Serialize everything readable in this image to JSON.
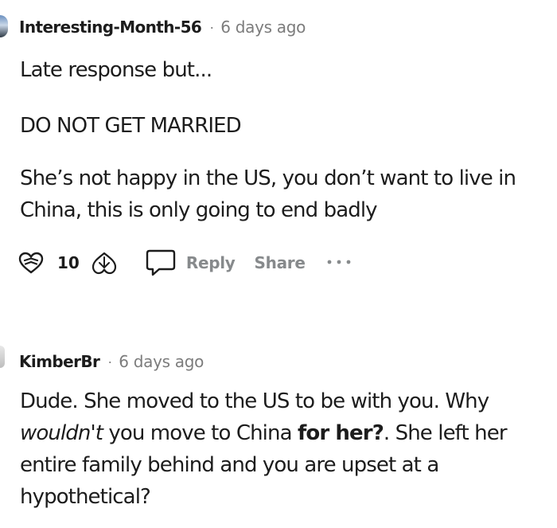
{
  "comments": [
    {
      "author": "Interesting-Month-56",
      "separator": "·",
      "time": "6 days ago",
      "paragraphs": [
        "Late response but...",
        "DO NOT GET MARRIED",
        "She’s not happy in the US, you don’t want to live in",
        "China, this is only going to end badly"
      ],
      "vote_count": "10",
      "reply_label": "Reply",
      "share_label": "Share",
      "more_label": "•••"
    },
    {
      "author": "KimberBr",
      "separator": "·",
      "time": "6 days ago",
      "lines": {
        "l1": "Dude. She moved to the US to be with you. Why",
        "l2_em": "wouldn't",
        "l2_mid": " you move to China ",
        "l2_strong": "for her?",
        "l2_end": ". She left her",
        "l3": "entire family behind and you are upset at a",
        "l4": "hypothetical?"
      }
    }
  ],
  "icons": {
    "upvote": "heart-upvote-icon",
    "downvote": "heart-downvote-icon",
    "reply": "speech-bubble-icon",
    "more": "ellipsis-icon"
  },
  "colors": {
    "text": "#1c1c1c",
    "meta": "#7c7c7c",
    "action": "#878a8c"
  }
}
